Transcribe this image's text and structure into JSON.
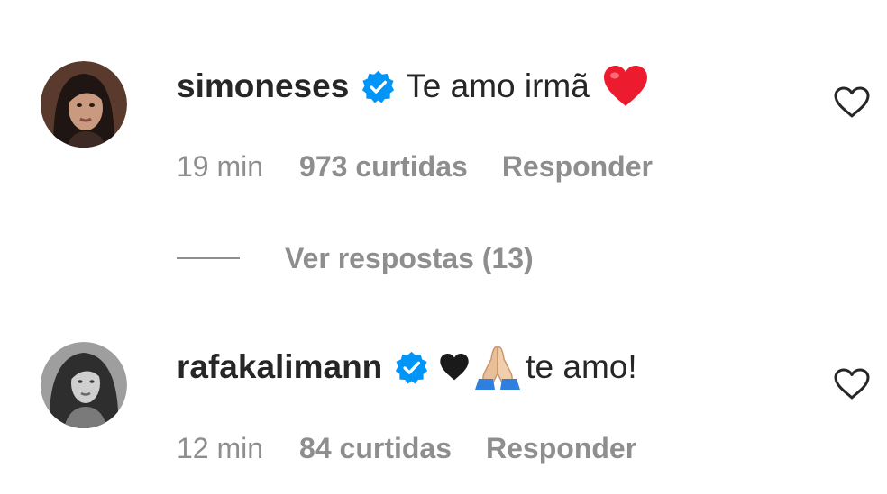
{
  "comments": [
    {
      "username": "simoneses",
      "text": "Te amo irmã",
      "emoji_icons": [
        "red-heart-icon"
      ],
      "time": "19 min",
      "likes": "973 curtidas",
      "reply_label": "Responder",
      "verified": true,
      "avatar_icon": "avatar-icon"
    },
    {
      "username": "rafakalimann",
      "text": "te amo!",
      "emoji_icons": [
        "black-heart-icon",
        "folded-hands-icon"
      ],
      "time": "12 min",
      "likes": "84 curtidas",
      "reply_label": "Responder",
      "verified": true,
      "avatar_icon": "avatar-icon"
    }
  ],
  "view_replies": {
    "label": "Ver respostas (13)"
  },
  "colors": {
    "text": "#262626",
    "secondary": "#8e8e8e",
    "verified": "#0095f6",
    "red_heart": "#ed1b2e",
    "black_heart": "#1a1a1a",
    "folded_hands": "#e8bf98"
  }
}
